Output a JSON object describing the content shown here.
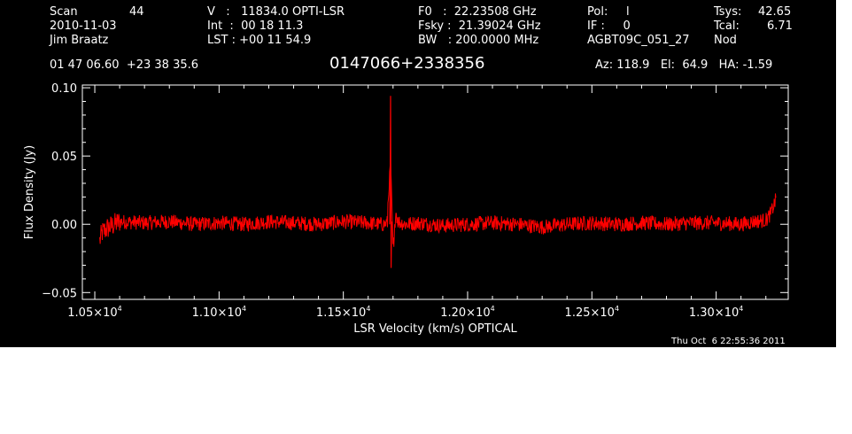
{
  "header": {
    "col1": {
      "scan_label": "Scan",
      "scan_value": "44",
      "date": "2010-11-03",
      "observer": "Jim Braatz"
    },
    "col2": {
      "v_line": "V   :   11834.0 OPTI-LSR",
      "int_line": "Int  :  00 18 11.3",
      "lst_line": "LST : +00 11 54.9"
    },
    "col3": {
      "f0_line": "F0   :  22.23508 GHz",
      "fsky_line": "Fsky :  21.39024 GHz",
      "bw_line": "BW   : 200.0000 MHz"
    },
    "col4": {
      "pol_line": "Pol:     l",
      "if_line": "IF :     0",
      "project": "AGBT09C_051_27"
    },
    "col5": {
      "tsys_label": "Tsys:",
      "tsys_value": "42.65",
      "tcal_label": "Tcal:",
      "tcal_value": "6.71",
      "mode": "Nod"
    },
    "coords": "01 47 06.60  +23 38 35.6",
    "source": "0147066+2338356",
    "pointing": "Az: 118.9   El:  64.9   HA: -1.59"
  },
  "timestamp": "Thu Oct  6 22:55:36 2011",
  "colors": {
    "background": "#000000",
    "axes": "#ffffff",
    "trace": "#ff0000"
  },
  "chart_data": {
    "type": "line",
    "xlabel": "LSR Velocity (km/s) OPTICAL",
    "ylabel": "Flux Density (Jy)",
    "xlim": [
      10450,
      13290
    ],
    "ylim": [
      -0.055,
      0.102
    ],
    "x_ticks": [
      {
        "label": "1.05×10",
        "exp": "4",
        "value": 10500
      },
      {
        "label": "1.10×10",
        "exp": "4",
        "value": 11000
      },
      {
        "label": "1.15×10",
        "exp": "4",
        "value": 11500
      },
      {
        "label": "1.20×10",
        "exp": "4",
        "value": 12000
      },
      {
        "label": "1.25×10",
        "exp": "4",
        "value": 12500
      },
      {
        "label": "1.30×10",
        "exp": "4",
        "value": 13000
      }
    ],
    "y_ticks": [
      {
        "label": "0.10",
        "value": 0.1
      },
      {
        "label": "0.05",
        "value": 0.05
      },
      {
        "label": "0.00",
        "value": 0.0
      },
      {
        "label": "−0.05",
        "value": -0.05
      }
    ],
    "series": [
      {
        "x": [
          10520,
          10530,
          10550,
          10600,
          10700,
          10800,
          10900,
          11000,
          11100,
          11200,
          11300,
          11400,
          11500,
          11600,
          11650,
          11680,
          11690,
          11700,
          11710,
          11720,
          11750,
          11800,
          11900,
          12000,
          12100,
          12200,
          12300,
          12400,
          12500,
          12600,
          12700,
          12800,
          12900,
          13000,
          13100,
          13150,
          13200,
          13220,
          13240
        ],
        "y": [
          -0.012,
          -0.006,
          -0.003,
          0.002,
          0.001,
          0.002,
          0.0,
          0.001,
          0.0,
          0.002,
          0.001,
          0.0,
          0.002,
          0.001,
          0.0,
          0.03,
          0.094,
          -0.032,
          0.01,
          0.002,
          0.0,
          0.001,
          -0.001,
          0.0,
          0.001,
          0.0,
          -0.002,
          0.0,
          0.001,
          0.0,
          0.001,
          0.0,
          0.001,
          0.001,
          0.0,
          0.002,
          0.003,
          0.008,
          0.018
        ]
      }
    ]
  }
}
